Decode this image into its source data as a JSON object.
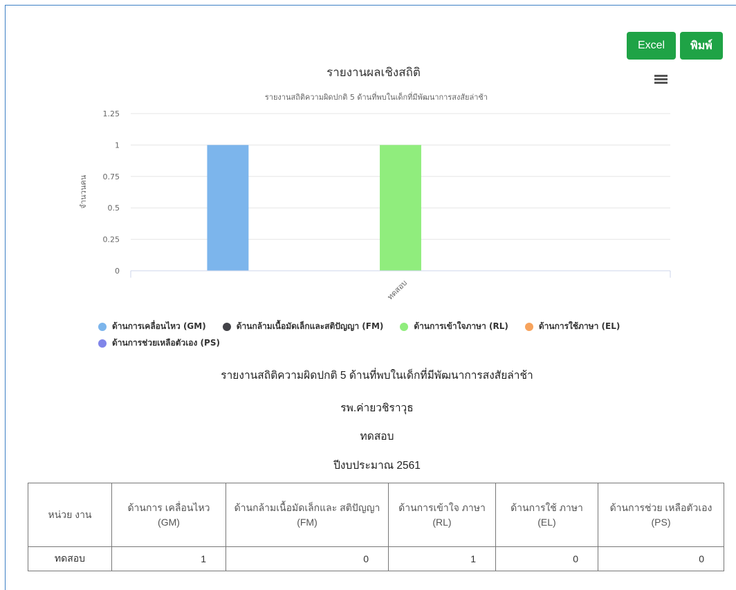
{
  "buttons": {
    "excel": "Excel",
    "print": "พิมพ์"
  },
  "menu_icon": "hamburger-menu-icon",
  "chart_data": {
    "type": "bar",
    "title": "รายงานผลเชิงสถิติ",
    "subtitle": "รายงานสถิติความผิดปกติ 5 ด้านที่พบในเด็กที่มีพัฒนาการสงสัยล่าช้า",
    "ylabel": "จำนวนคน",
    "xlabel": "",
    "categories": [
      "ทดสอบ"
    ],
    "ylim": [
      0,
      1.25
    ],
    "yticks": [
      "0",
      "0.25",
      "0.5",
      "0.75",
      "1",
      "1.25"
    ],
    "grid": true,
    "legend_position": "bottom",
    "series": [
      {
        "name": "ด้านการเคลื่อนไหว (GM)",
        "color": "#7cb5ec",
        "values": [
          1
        ]
      },
      {
        "name": "ด้านกล้ามเนื้อมัดเล็กและสติปัญญา (FM)",
        "color": "#434348",
        "values": [
          0
        ]
      },
      {
        "name": "ด้านการเข้าใจภาษา (RL)",
        "color": "#90ed7d",
        "values": [
          1
        ]
      },
      {
        "name": "ด้านการใช้ภาษา (EL)",
        "color": "#f7a35c",
        "values": [
          0
        ]
      },
      {
        "name": "ด้านการช่วยเหลือตัวเอง (PS)",
        "color": "#8085e9",
        "values": [
          0
        ]
      }
    ]
  },
  "report": {
    "title": "รายงานสถิติความผิดปกติ 5 ด้านที่พบในเด็กที่มีพัฒนาการสงสัยล่าช้า",
    "hospital": "รพ.ค่ายวชิราวุธ",
    "unit": "ทดสอบ",
    "fiscal_year": "ปีงบประมาณ 2561"
  },
  "table": {
    "headers": [
      "หน่วย งาน",
      "ด้านการ เคลื่อนไหว (GM)",
      "ด้านกล้ามเนื้อมัดเล็กและ สติปัญญา (FM)",
      "ด้านการเข้าใจ ภาษา (RL)",
      "ด้านการใช้ ภาษา (EL)",
      "ด้านการช่วย เหลือตัวเอง (PS)"
    ],
    "rows": [
      [
        "ทดสอบ",
        "1",
        "0",
        "1",
        "0",
        "0"
      ]
    ]
  }
}
